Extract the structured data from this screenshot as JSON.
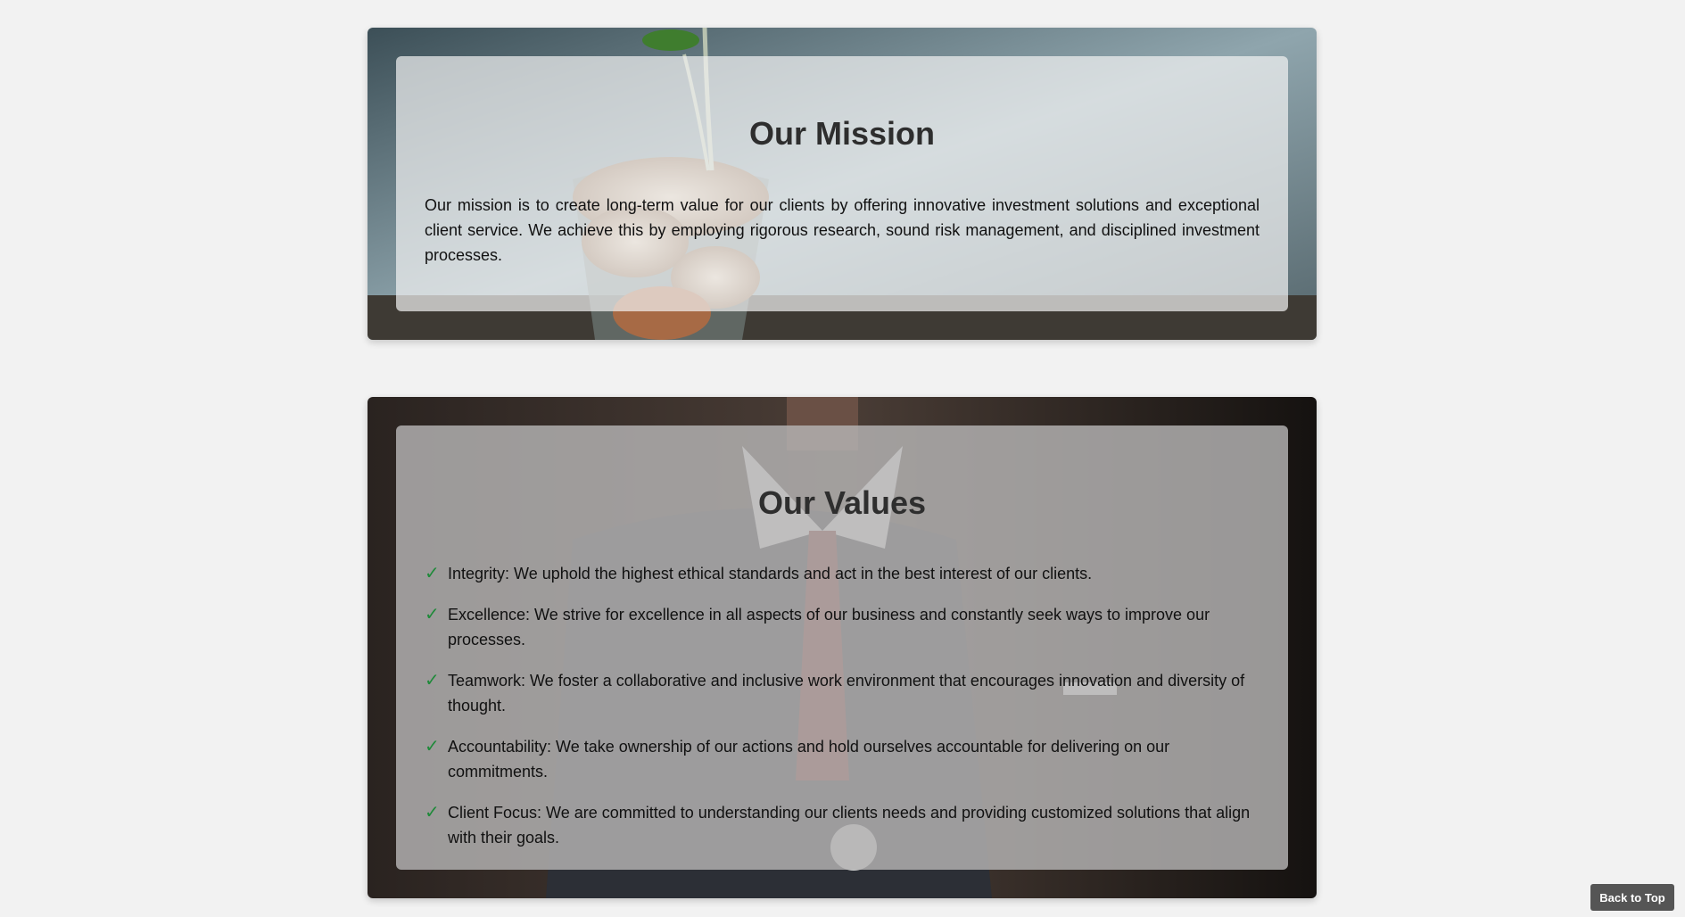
{
  "mission": {
    "title": "Our Mission",
    "text": "Our mission is to create long-term value for our clients by offering innovative investment solutions and exceptional client service. We achieve this by employing rigorous research, sound risk management, and disciplined investment processes."
  },
  "values": {
    "title": "Our Values",
    "items": [
      "Integrity: We uphold the highest ethical standards and act in the best interest of our clients.",
      "Excellence: We strive for excellence in all aspects of our business and constantly seek ways to improve our processes.",
      "Teamwork: We foster a collaborative and inclusive work environment that encourages innovation and diversity of thought.",
      "Accountability: We take ownership of our actions and hold ourselves accountable for delivering on our commitments.",
      "Client Focus: We are committed to understanding our clients needs and providing customized solutions that align with their goals."
    ],
    "check_icon": "checkmark-icon",
    "check_color": "#1f8a3a"
  },
  "back_to_top": {
    "label": "Back to Top"
  }
}
